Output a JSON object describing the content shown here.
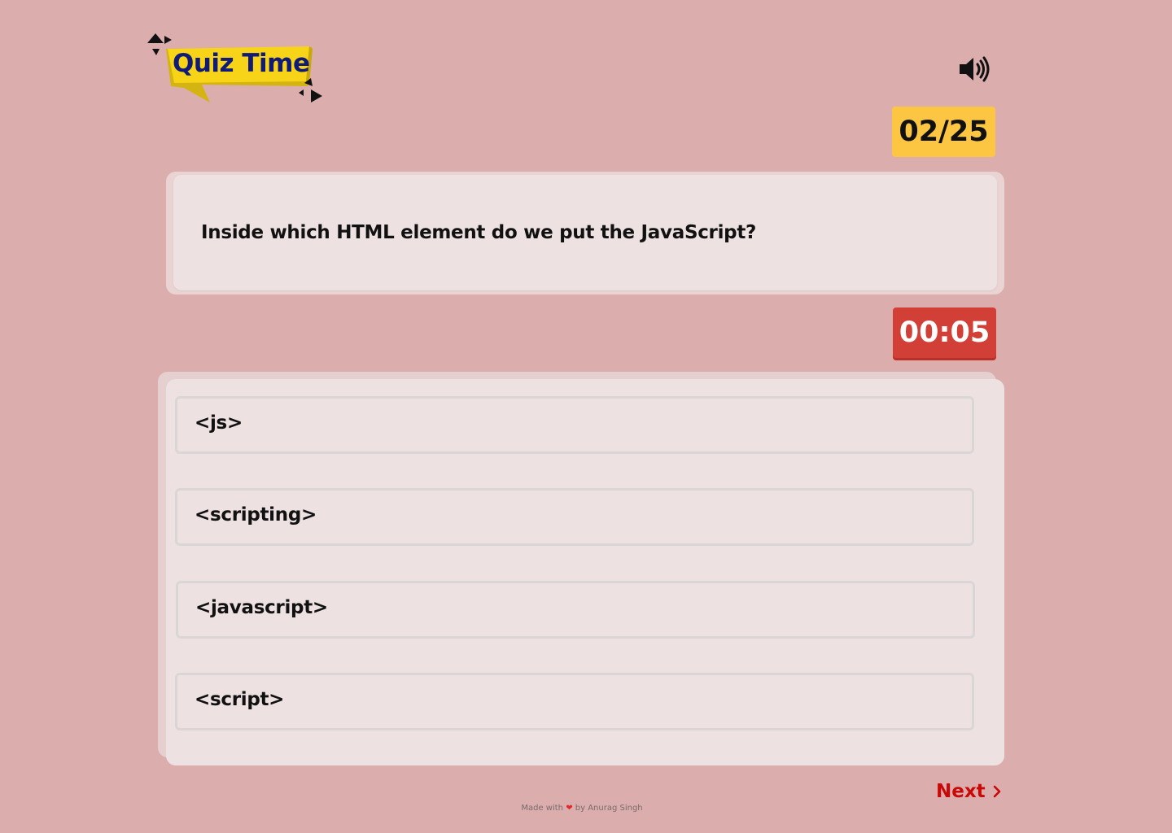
{
  "header": {
    "logo_text": "Quiz Time",
    "sound_icon": "volume-icon"
  },
  "progress": {
    "counter": "02/25"
  },
  "question": {
    "text": "Inside which HTML element do we put the JavaScript?"
  },
  "timer": {
    "value": "00:05"
  },
  "options": [
    {
      "label": "<js>"
    },
    {
      "label": "<scripting>"
    },
    {
      "label": "<javascript>"
    },
    {
      "label": "<script>"
    }
  ],
  "nav": {
    "next_label": "Next",
    "next_icon": "chevron-right-icon"
  },
  "footer": {
    "made_with": "Made with",
    "heart_icon": "heart-icon",
    "by_text": "by Anurag Singh"
  },
  "colors": {
    "background": "#dbadad",
    "counter": "#fcc643",
    "timer": "#d13f37",
    "next": "#c90808",
    "logo_banner": "#f7d417",
    "logo_text": "#101a78"
  }
}
